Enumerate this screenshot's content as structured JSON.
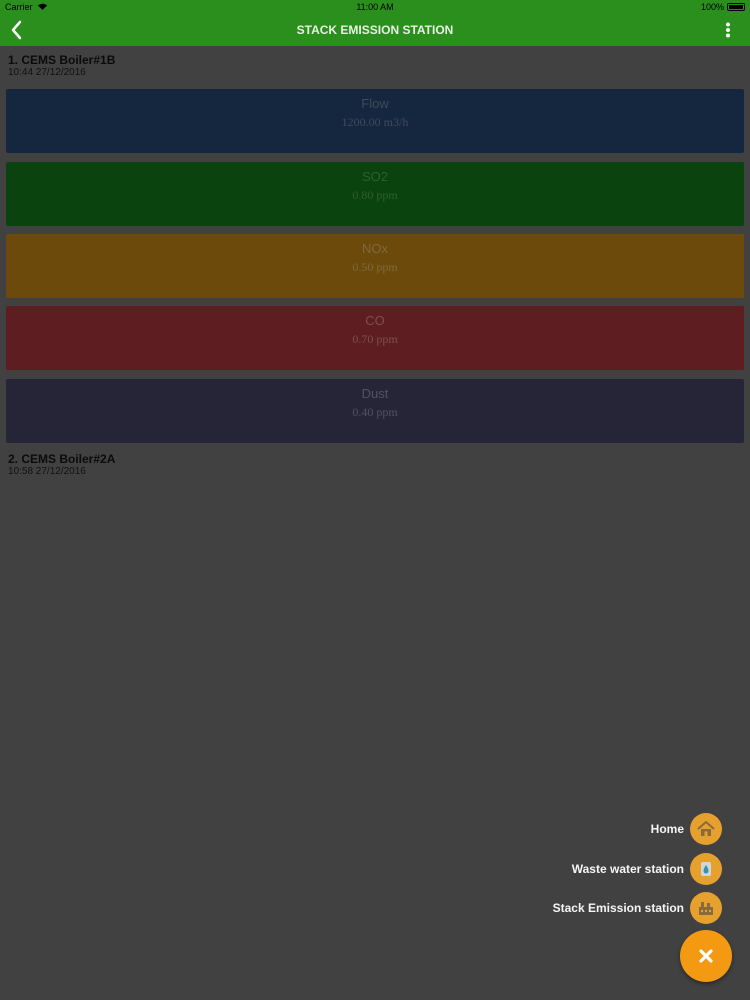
{
  "status_bar": {
    "carrier": "Carrier",
    "time": "11:00 AM",
    "battery": "100%"
  },
  "header": {
    "title": "STACK EMISSION STATION",
    "color": "#2a8f1c"
  },
  "stations": [
    {
      "name": "1. CEMS Boiler#1B",
      "timestamp": "10:44 27/12/2016",
      "readings": [
        {
          "label": "Flow",
          "value": "1200.00 m3/h",
          "color": "#14273e"
        },
        {
          "label": "SO2",
          "value": "0.80 ppm",
          "color": "#0a430e"
        },
        {
          "label": "NOx",
          "value": "0.50 ppm",
          "color": "#6b4a0c"
        },
        {
          "label": "CO",
          "value": "0.70 ppm",
          "color": "#5e1e21"
        },
        {
          "label": "Dust",
          "value": "0.40 ppm",
          "color": "#262538"
        }
      ]
    },
    {
      "name": "2. CEMS Boiler#2A",
      "timestamp": "10:58 27/12/2016"
    }
  ],
  "fab_menu": {
    "items": [
      {
        "label": "Home",
        "icon": "home-icon"
      },
      {
        "label": "Waste water station",
        "icon": "water-drop-icon"
      },
      {
        "label": "Stack Emission station",
        "icon": "factory-icon"
      }
    ],
    "close_icon": "close-icon",
    "accent": "#f39a12"
  }
}
